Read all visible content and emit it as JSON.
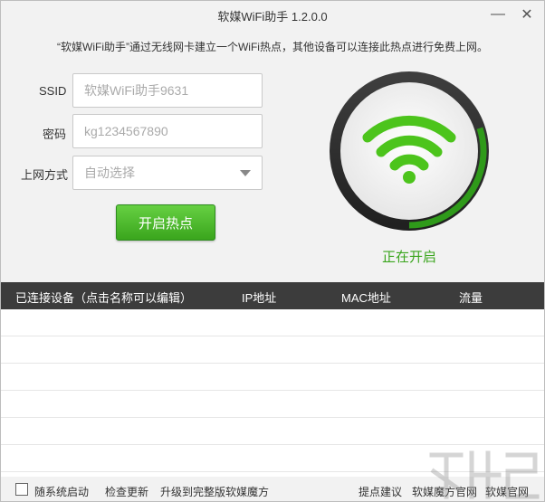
{
  "window": {
    "title": "软媒WiFi助手 1.2.0.0",
    "minimize_glyph": "—",
    "close_glyph": "✕"
  },
  "description": "“软媒WiFi助手”通过无线网卡建立一个WiFi热点，其他设备可以连接此热点进行免费上网。",
  "form": {
    "ssid_label": "SSID",
    "ssid_value": "软媒WiFi助手9631",
    "password_label": "密码",
    "password_value": "kg1234567890",
    "method_label": "上网方式",
    "method_value": "自动选择"
  },
  "start_button": "开启热点",
  "status": {
    "text": "正在开启",
    "progress": 0.3
  },
  "table": {
    "headers": [
      "已连接设备（点击名称可以编辑）",
      "IP地址",
      "MAC地址",
      "流量"
    ],
    "rows": []
  },
  "footer": {
    "autostart_label": "随系统启动",
    "check_update": "检查更新",
    "upgrade": "升级到完整版软媒魔方",
    "feedback": "提点建议",
    "official_mofang": "软媒魔方官网",
    "official_ruanmei": "软媒官网"
  },
  "colors": {
    "accent_green": "#3aa51d",
    "header_dark": "#3c3c3c",
    "background": "#f2f2f2"
  },
  "icons": {
    "wifi": "wifi-icon",
    "dropdown": "chevron-down-icon",
    "minimize": "minimize-icon",
    "close": "close-icon"
  }
}
